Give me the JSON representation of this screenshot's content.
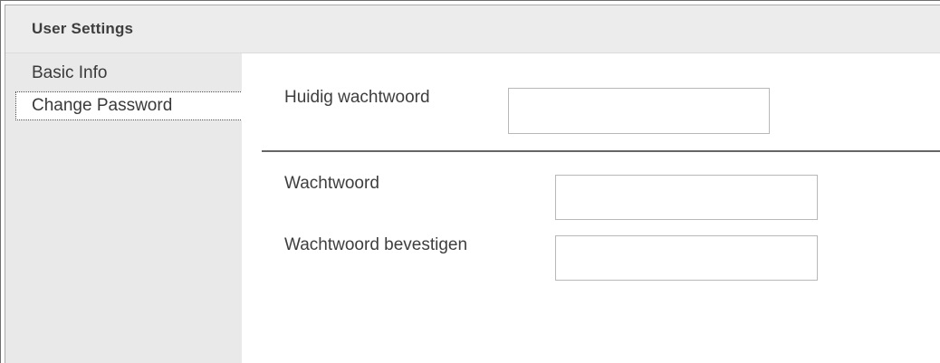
{
  "header": {
    "title": "User Settings"
  },
  "sidebar": {
    "items": [
      {
        "label": "Basic Info",
        "active": false
      },
      {
        "label": "Change Password",
        "active": true
      }
    ]
  },
  "form": {
    "current_password": {
      "label": "Huidig wachtwoord",
      "value": ""
    },
    "new_password": {
      "label": "Wachtwoord",
      "value": ""
    },
    "confirm_password": {
      "label": "Wachtwoord bevestigen",
      "value": ""
    }
  },
  "colors": {
    "header_bg": "#ececec",
    "sidebar_bg": "#e9e9e9",
    "text": "#3e3e3e",
    "separator": "#666666"
  }
}
